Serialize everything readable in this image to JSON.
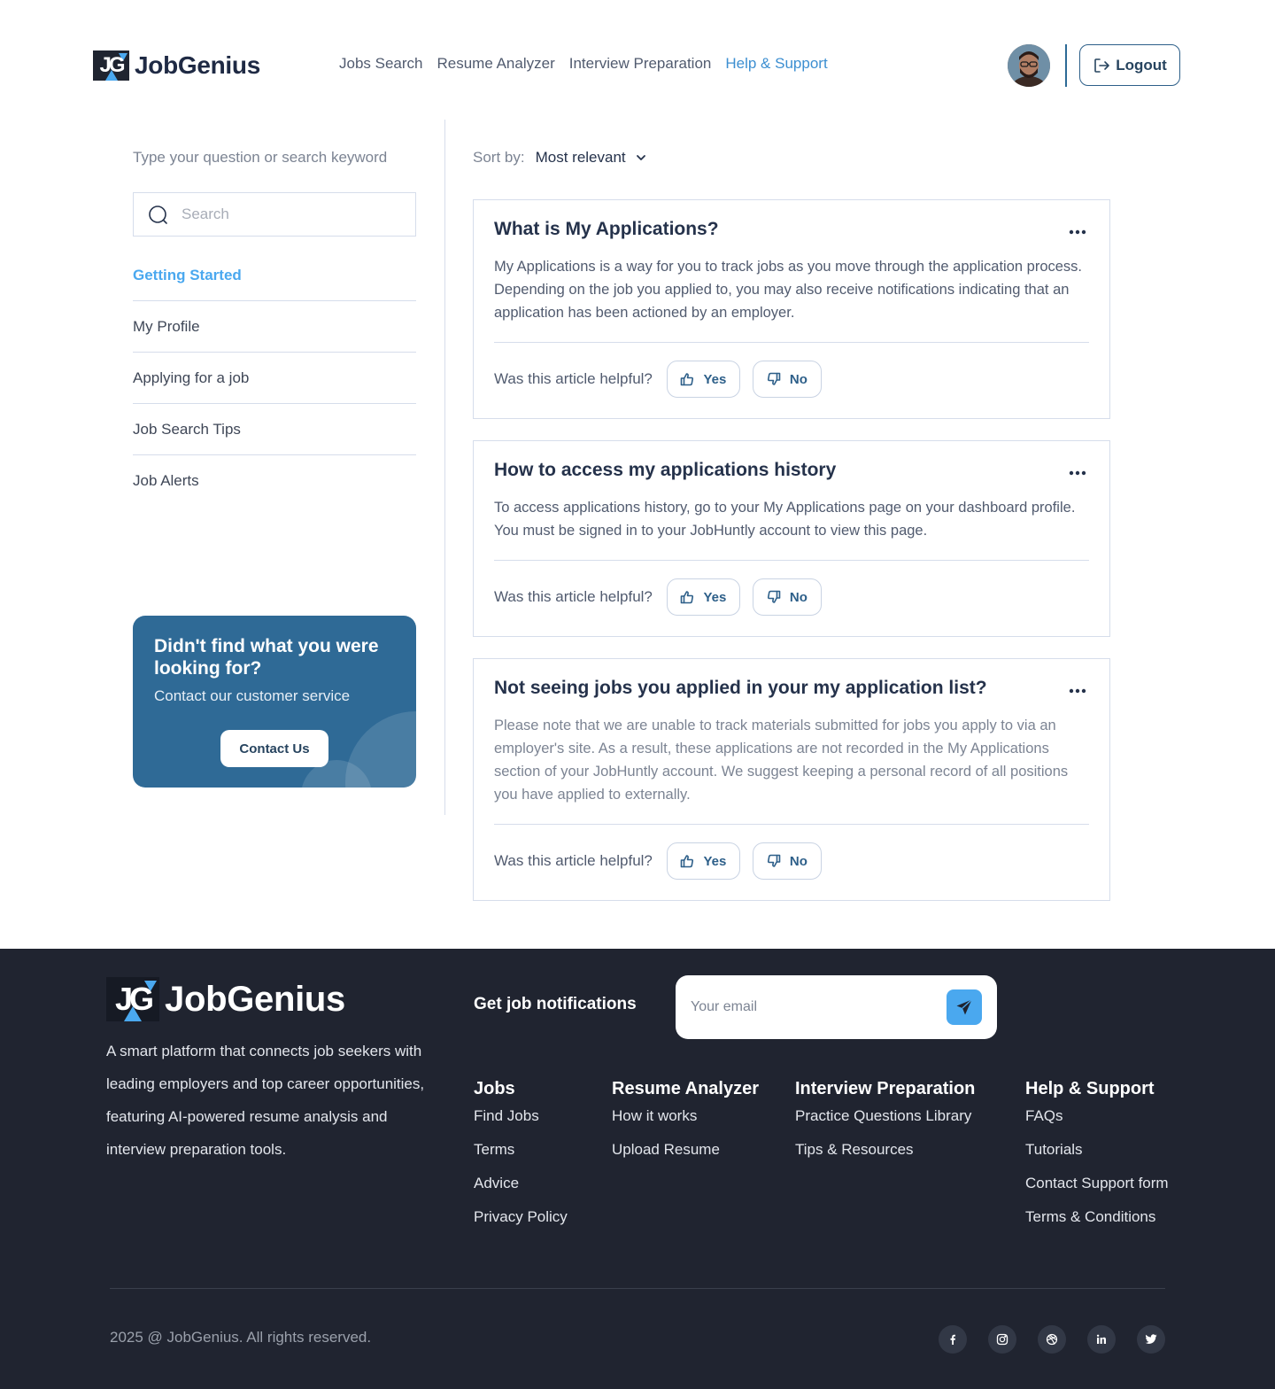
{
  "brand": {
    "name": "JobGenius",
    "mark": "JG"
  },
  "nav": {
    "items": [
      {
        "label": "Jobs Search"
      },
      {
        "label": "Resume Analyzer"
      },
      {
        "label": "Interview Preparation"
      },
      {
        "label": "Help & Support"
      }
    ],
    "active": "Help & Support"
  },
  "header": {
    "logout_label": "Logout"
  },
  "sidebar": {
    "search_hint": "Type your question or search keyword",
    "search_placeholder": "Search",
    "categories": [
      {
        "label": "Getting Started"
      },
      {
        "label": "My Profile"
      },
      {
        "label": "Applying for a job"
      },
      {
        "label": "Job Search Tips"
      },
      {
        "label": "Job Alerts"
      }
    ],
    "active_category": "Getting Started",
    "help_card": {
      "title": "Didn't find what you were looking for?",
      "subtitle": "Contact our customer service",
      "button_label": "Contact Us"
    }
  },
  "main": {
    "sort_label": "Sort by:",
    "sort_value": "Most relevant",
    "helpful_question": "Was this article helpful?",
    "yes_label": "Yes",
    "no_label": "No",
    "articles": [
      {
        "title": "What is My Applications?",
        "body": "My Applications is a way for you to track jobs as you move through the application process. Depending on the job you applied to, you may also receive notifications indicating that an application has been actioned by an employer."
      },
      {
        "title": "How to access my applications history",
        "body": "To access applications history, go to your My Applications page on your dashboard profile. You must be signed in to your JobHuntly account to view this page."
      },
      {
        "title": "Not seeing jobs you applied in your my application list?",
        "body": "Please note that we are unable to track materials submitted for jobs you apply to via an employer's site. As a result, these applications are not recorded in the My Applications section of your JobHuntly account. We suggest keeping a personal record of all positions you have applied to externally."
      }
    ]
  },
  "footer": {
    "description": "A smart platform that connects job seekers with leading employers and top career opportunities, featuring AI-powered resume analysis and interview preparation tools.",
    "notifications_title": "Get job notifications",
    "email_placeholder": "Your email",
    "columns": [
      {
        "title": "Jobs",
        "links": [
          "Find Jobs",
          "Terms",
          "Advice",
          "Privacy Policy"
        ]
      },
      {
        "title": "Resume Analyzer",
        "links": [
          "How it works",
          "Upload Resume"
        ]
      },
      {
        "title": "Interview Preparation",
        "links": [
          "Practice Questions Library",
          "Tips & Resources"
        ]
      },
      {
        "title": "Help & Support",
        "links": [
          "FAQs",
          "Tutorials",
          "Contact Support form",
          "Terms & Conditions"
        ]
      }
    ],
    "copyright": "2025 @ JobGenius. All rights reserved.",
    "socials": [
      "facebook-icon",
      "instagram-icon",
      "dribbble-icon",
      "linkedin-icon",
      "twitter-icon"
    ]
  },
  "colors": {
    "accent": "#4aa8ef",
    "primary_dark": "#2d5f89",
    "help_card_bg": "#2f6a96",
    "footer_bg": "#202430"
  }
}
